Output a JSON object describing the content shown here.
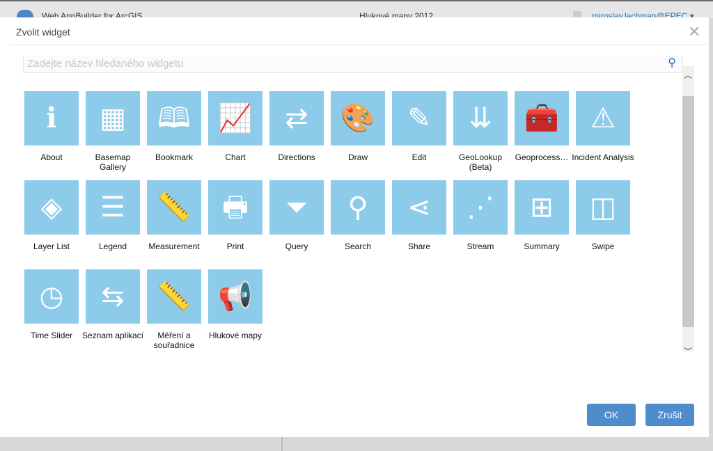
{
  "background": {
    "app_name": "Web AppBuilder for ArcGIS",
    "app_title": "Hlukové mapy 2012",
    "user": "miroslav.lachman@EPEC ▾"
  },
  "dialog": {
    "title": "Zvolit widget",
    "search_placeholder": "Zadejte název hledaného widgetu",
    "ok_label": "OK",
    "cancel_label": "Zrušit"
  },
  "colors": {
    "tile": "#8dcbea",
    "button": "#4f8ccb"
  },
  "widgets": [
    {
      "label": "About",
      "icon": "info-icon",
      "glyph": "ℹ"
    },
    {
      "label": "Basemap Gallery",
      "icon": "grid-icon",
      "glyph": "▦"
    },
    {
      "label": "Bookmark",
      "icon": "bookmark-icon",
      "glyph": "🕮"
    },
    {
      "label": "Chart",
      "icon": "chart-icon",
      "glyph": "📈"
    },
    {
      "label": "Directions",
      "icon": "directions-icon",
      "glyph": "⇄"
    },
    {
      "label": "Draw",
      "icon": "palette-icon",
      "glyph": "🎨"
    },
    {
      "label": "Edit",
      "icon": "edit-icon",
      "glyph": "✎"
    },
    {
      "label": "GeoLookup (Beta)",
      "icon": "geolookup-icon",
      "glyph": "⇊"
    },
    {
      "label": "Geoprocess…",
      "icon": "toolbox-icon",
      "glyph": "🧰"
    },
    {
      "label": "Incident Analysis",
      "icon": "warning-icon",
      "glyph": "⚠"
    },
    {
      "label": "Layer List",
      "icon": "layers-icon",
      "glyph": "◈"
    },
    {
      "label": "Legend",
      "icon": "legend-icon",
      "glyph": "☰"
    },
    {
      "label": "Measurement",
      "icon": "ruler-icon",
      "glyph": "📏"
    },
    {
      "label": "Print",
      "icon": "printer-icon",
      "glyph": "🖶"
    },
    {
      "label": "Query",
      "icon": "funnel-icon",
      "glyph": "⏷"
    },
    {
      "label": "Search",
      "icon": "search-icon",
      "glyph": "⚲"
    },
    {
      "label": "Share",
      "icon": "share-icon",
      "glyph": "⋖"
    },
    {
      "label": "Stream",
      "icon": "stream-icon",
      "glyph": "⋰"
    },
    {
      "label": "Summary",
      "icon": "calculator-icon",
      "glyph": "⊞"
    },
    {
      "label": "Swipe",
      "icon": "swipe-icon",
      "glyph": "◫"
    },
    {
      "label": "Time Slider",
      "icon": "clock-icon",
      "glyph": "◷"
    },
    {
      "label": "Seznam aplikací",
      "icon": "swap-arrows-icon",
      "glyph": "⇆"
    },
    {
      "label": "Měření a souřadnice",
      "icon": "ruler-icon",
      "glyph": "📏"
    },
    {
      "label": "Hlukové mapy",
      "icon": "megaphone-icon",
      "glyph": "📢"
    }
  ]
}
